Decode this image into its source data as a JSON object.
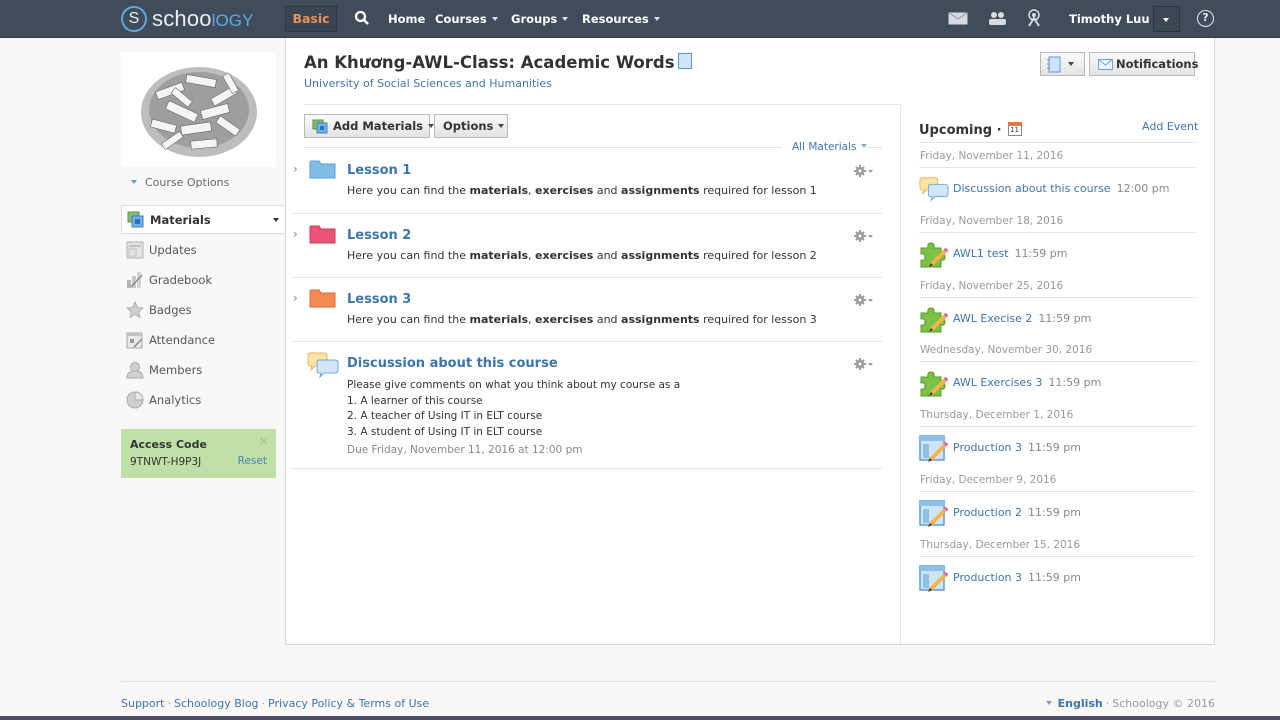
{
  "topnav": {
    "logo_main": "schoo",
    "logo_accent": "lOGY",
    "basic_label": "Basic",
    "links": [
      {
        "label": "Home",
        "dropdown": false
      },
      {
        "label": "Courses",
        "dropdown": true
      },
      {
        "label": "Groups",
        "dropdown": true
      },
      {
        "label": "Resources",
        "dropdown": true
      }
    ],
    "icons": [
      "mail-icon",
      "people-icon",
      "notifications-icon"
    ],
    "user_name": "Timothy Luu",
    "help_label": "?"
  },
  "sidebar": {
    "course_options_label": "Course Options",
    "active_item": "Materials",
    "items": [
      {
        "label": "Updates",
        "icon": "updates-icon"
      },
      {
        "label": "Gradebook",
        "icon": "gradebook-icon"
      },
      {
        "label": "Badges",
        "icon": "badges-icon"
      },
      {
        "label": "Attendance",
        "icon": "attendance-icon"
      },
      {
        "label": "Members",
        "icon": "members-icon"
      },
      {
        "label": "Analytics",
        "icon": "analytics-icon"
      }
    ],
    "access_code": {
      "title": "Access Code",
      "code": "9TNWT-H9P3J",
      "reset_label": "Reset",
      "close_label": "×"
    }
  },
  "header": {
    "title": "An Khương-AWL-Class: Academic Words",
    "subtitle": "University of Social Sciences and Humanities",
    "notifications_label": "Notifications"
  },
  "toolbar": {
    "add_materials_label": "Add Materials",
    "options_label": "Options",
    "filter_label": "All Materials"
  },
  "materials": [
    {
      "type": "folder",
      "color": "#7fbde6",
      "title": "Lesson 1",
      "desc_prefix": "Here you can find the ",
      "b1": "materials",
      "sep1": ", ",
      "b2": "exercises",
      "sep2": " and ",
      "b3": "assignments",
      "desc_suffix": " required for lesson 1"
    },
    {
      "type": "folder",
      "color": "#ec5476",
      "title": "Lesson 2",
      "desc_prefix": "Here you can find the ",
      "b1": "materials",
      "sep1": ", ",
      "b2": "exercises",
      "sep2": " and ",
      "b3": "assignments",
      "desc_suffix": " required for lesson 2"
    },
    {
      "type": "folder",
      "color": "#f68a55",
      "title": "Lesson 3",
      "desc_prefix": "Here you can find the ",
      "b1": "materials",
      "sep1": ", ",
      "b2": "exercises",
      "sep2": " and ",
      "b3": "assignments",
      "desc_suffix": " required for lesson 3"
    }
  ],
  "discussion": {
    "title": "Discussion about this course",
    "lines": [
      "Please give comments on what you think about my course as a",
      "1. A learner of this course",
      "2. A teacher of Using IT in ELT course",
      "3. A student of Using IT in ELT course"
    ],
    "due": "Due Friday, November 11, 2016 at 12:00 pm"
  },
  "upcoming": {
    "title": "Upcoming",
    "calendar_day": "11",
    "add_event_label": "Add Event",
    "groups": [
      {
        "date": "Friday, November 11, 2016",
        "event": "Discussion about this course",
        "time": "12:00 pm",
        "icon": "discussion-icon"
      },
      {
        "date": "Friday, November 18, 2016",
        "event": "AWL1 test",
        "time": "11:59 pm",
        "icon": "assessment-icon"
      },
      {
        "date": "Friday, November 25, 2016",
        "event": "AWL Execise 2",
        "time": "11:59 pm",
        "icon": "assessment-icon"
      },
      {
        "date": "Wednesday, November 30, 2016",
        "event": "AWL Exercises 3",
        "time": "11:59 pm",
        "icon": "assessment-icon"
      },
      {
        "date": "Thursday, December 1, 2016",
        "event": "Production 3",
        "time": "11:59 pm",
        "icon": "assignment-icon"
      },
      {
        "date": "Friday, December 9, 2016",
        "event": "Production 2",
        "time": "11:59 pm",
        "icon": "assignment-icon"
      },
      {
        "date": "Thursday, December 15, 2016",
        "event": "Production 3",
        "time": "11:59 pm",
        "icon": "assignment-icon"
      }
    ]
  },
  "footer": {
    "links": [
      "Support",
      "Schoology Blog",
      "Privacy Policy & Terms of Use"
    ],
    "language": "English",
    "copyright": "Schoology © 2016"
  }
}
